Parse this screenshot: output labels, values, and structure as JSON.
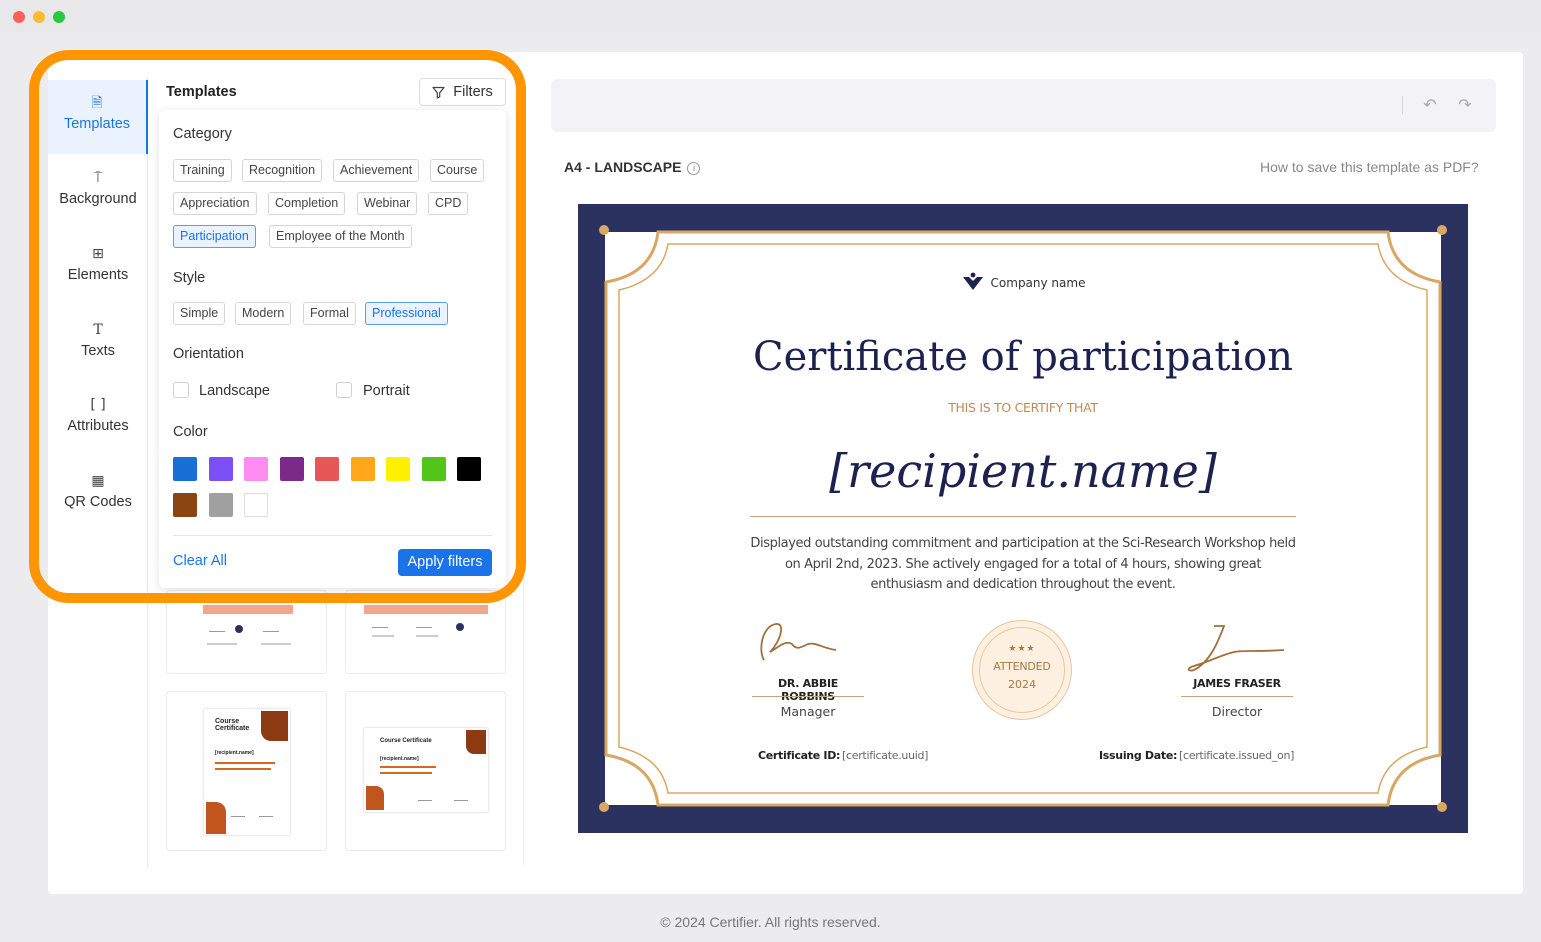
{
  "window": {
    "controls": [
      "close",
      "minimize",
      "maximize"
    ]
  },
  "sidebar": {
    "items": [
      {
        "label": "Templates",
        "icon": "document-icon",
        "active": true
      },
      {
        "label": "Background",
        "icon": "paint-roller-icon",
        "active": false
      },
      {
        "label": "Elements",
        "icon": "elements-grid-icon",
        "active": false
      },
      {
        "label": "Texts",
        "icon": "text-icon",
        "active": false
      },
      {
        "label": "Attributes",
        "icon": "brackets-icon",
        "active": false
      },
      {
        "label": "QR Codes",
        "icon": "qr-code-icon",
        "active": false
      }
    ]
  },
  "templates_panel": {
    "title": "Templates",
    "filters_label": "Filters"
  },
  "filter_panel": {
    "category_label": "Category",
    "categories": [
      {
        "label": "Training",
        "selected": false
      },
      {
        "label": "Recognition",
        "selected": false
      },
      {
        "label": "Achievement",
        "selected": false
      },
      {
        "label": "Course",
        "selected": false
      },
      {
        "label": "Appreciation",
        "selected": false
      },
      {
        "label": "Completion",
        "selected": false
      },
      {
        "label": "Webinar",
        "selected": false
      },
      {
        "label": "CPD",
        "selected": false
      },
      {
        "label": "Participation",
        "selected": true
      },
      {
        "label": "Employee of the Month",
        "selected": false
      }
    ],
    "style_label": "Style",
    "styles": [
      {
        "label": "Simple",
        "selected": false
      },
      {
        "label": "Modern",
        "selected": false
      },
      {
        "label": "Formal",
        "selected": false
      },
      {
        "label": "Professional",
        "selected": true
      }
    ],
    "orientation_label": "Orientation",
    "orientations": [
      {
        "label": "Landscape",
        "checked": false
      },
      {
        "label": "Portrait",
        "checked": false
      }
    ],
    "color_label": "Color",
    "colors": [
      "#1a6fd6",
      "#7b4ff5",
      "#ff8cf0",
      "#7b2a8a",
      "#e85757",
      "#ffa61a",
      "#fff000",
      "#52c41a",
      "#000000",
      "#8b4513",
      "#a0a0a0",
      "#ffffff"
    ],
    "clear_label": "Clear All",
    "apply_label": "Apply filters"
  },
  "template_thumbs": [
    {
      "title": "",
      "recipient": ""
    },
    {
      "title": "",
      "recipient": ""
    },
    {
      "title": "Course Certificate",
      "recipient": "[recipient.name]"
    },
    {
      "title": "Course Certificate",
      "recipient": "[recipient.name]"
    }
  ],
  "editor": {
    "page_size": "A4 - LANDSCAPE",
    "help_link": "How to save this template as PDF?",
    "toolbar_icons": [
      "undo-icon",
      "redo-icon"
    ]
  },
  "certificate": {
    "company": "Company name",
    "title": "Certificate of participation",
    "certify": "THIS IS TO CERTIFY THAT",
    "recipient": "[recipient.name]",
    "description": "Displayed outstanding commitment and participation at the Sci-Research Workshop held on April 2nd, 2023. She actively engaged for a total of 4 hours, showing great enthusiasm and dedication throughout the event.",
    "signer_left": {
      "name": "DR. ABBIE ROBBINS",
      "role": "Manager"
    },
    "signer_right": {
      "name": "JAMES FRASER",
      "role": "Director"
    },
    "seal": {
      "stars": "★★★",
      "text": "ATTENDED",
      "year": "2024"
    },
    "id_label": "Certificate ID:",
    "id_value": "[certificate.uuid]",
    "date_label": "Issuing Date:",
    "date_value": "[certificate.issued_on]",
    "colors": {
      "frame": "#2c3260",
      "gold": "#d8a863"
    }
  },
  "footer": "© 2024 Certifier. All rights reserved."
}
